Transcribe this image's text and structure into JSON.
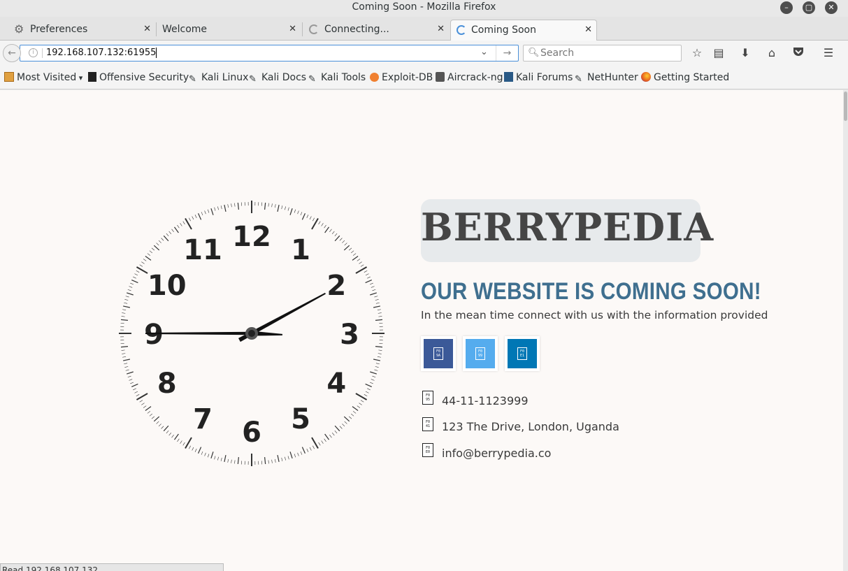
{
  "window": {
    "title": "Coming Soon - Mozilla Firefox",
    "minimize_icon": "minimize-icon",
    "maximize_icon": "maximize-icon",
    "close_icon": "close-icon"
  },
  "tabs": [
    {
      "label": "Preferences",
      "icon": "gear-icon",
      "active": false
    },
    {
      "label": "Welcome",
      "icon": "",
      "active": false
    },
    {
      "label": "Connecting...",
      "icon": "loading-icon",
      "active": false
    },
    {
      "label": "Coming Soon",
      "icon": "loading-icon",
      "active": true
    }
  ],
  "navbar": {
    "url": "192.168.107.132:61955",
    "search_placeholder": "Search"
  },
  "bookmarks": [
    {
      "label": "Most Visited",
      "icon": "folder-icon",
      "dropdown": true
    },
    {
      "label": "Offensive Security",
      "icon": "offsec-icon"
    },
    {
      "label": "Kali Linux",
      "icon": "kali-icon"
    },
    {
      "label": "Kali Docs",
      "icon": "kali-icon"
    },
    {
      "label": "Kali Tools",
      "icon": "kali-icon"
    },
    {
      "label": "Exploit-DB",
      "icon": "exploitdb-icon"
    },
    {
      "label": "Aircrack-ng",
      "icon": "aircrack-icon"
    },
    {
      "label": "Kali Forums",
      "icon": "kali-forums-icon"
    },
    {
      "label": "NetHunter",
      "icon": "kali-icon"
    },
    {
      "label": "Getting Started",
      "icon": "firefox-icon"
    }
  ],
  "page": {
    "clock": {
      "numerals": [
        "12",
        "1",
        "2",
        "3",
        "4",
        "5",
        "6",
        "7",
        "8",
        "9",
        "10",
        "11"
      ],
      "time": {
        "hour": 1,
        "minute": 15,
        "second": 45
      }
    },
    "logo": "BERRYPEDIA",
    "headline": "OUR WEBSITE IS COMING SOON!",
    "subline": "In the mean time connect with us with the information provided",
    "social": [
      {
        "name": "facebook",
        "glyph": "F0 9A",
        "color": "#3b5998"
      },
      {
        "name": "twitter",
        "glyph": "F0 99",
        "color": "#55acee"
      },
      {
        "name": "linkedin",
        "glyph": "F0 E1",
        "color": "#0077b5"
      }
    ],
    "contacts": [
      {
        "icon": "phone-icon",
        "glyph": "F0 95",
        "text": "44-11-1123999"
      },
      {
        "icon": "map-marker-icon",
        "glyph": "F0 41",
        "text": "123 The Drive, London, Uganda"
      },
      {
        "icon": "envelope-icon",
        "glyph": "F0 E0",
        "text": "info@berrypedia.co"
      }
    ]
  },
  "status": "Read 192.168.107.132"
}
